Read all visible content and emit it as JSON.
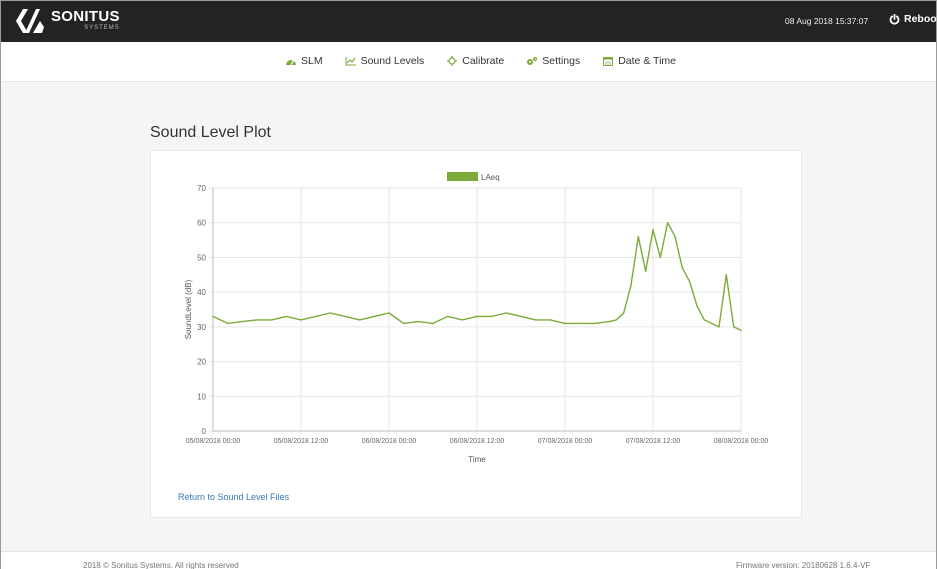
{
  "header": {
    "brand_name": "SONITUS",
    "brand_sub": "SYSTEMS",
    "datetime": "08 Aug 2018 15:37:07",
    "reboot_label": "Reboot"
  },
  "nav": {
    "items": [
      {
        "label": "SLM",
        "icon": "dashboard-icon"
      },
      {
        "label": "Sound Levels",
        "icon": "line-chart-icon"
      },
      {
        "label": "Calibrate",
        "icon": "crosshair-icon"
      },
      {
        "label": "Settings",
        "icon": "cogs-icon"
      },
      {
        "label": "Date & Time",
        "icon": "calendar-icon"
      }
    ]
  },
  "page": {
    "title": "Sound Level Plot",
    "return_link": "Return to Sound Level Files"
  },
  "chart_data": {
    "type": "line",
    "ylabel": "SoundLevel (dB)",
    "xlabel": "Time",
    "ylim": [
      0,
      70
    ],
    "yticks": [
      0,
      10,
      20,
      30,
      40,
      50,
      60,
      70
    ],
    "xticks": [
      "05/08/2018 00:00",
      "05/08/2018 12:00",
      "06/08/2018 00:00",
      "06/08/2018 12:00",
      "07/08/2018 00:00",
      "07/08/2018 12:00",
      "08/08/2018 00:00"
    ],
    "xlim": [
      "05/08/2018 00:00",
      "08/08/2018 00:00"
    ],
    "grid": true,
    "legend": "top-center",
    "color": "#7cab3a",
    "series": [
      {
        "name": "LAeq",
        "x": [
          "05/08/2018 00:00",
          "05/08/2018 02:00",
          "05/08/2018 04:00",
          "05/08/2018 06:00",
          "05/08/2018 08:00",
          "05/08/2018 10:00",
          "05/08/2018 12:00",
          "05/08/2018 14:00",
          "05/08/2018 16:00",
          "05/08/2018 18:00",
          "05/08/2018 20:00",
          "05/08/2018 22:00",
          "06/08/2018 00:00",
          "06/08/2018 02:00",
          "06/08/2018 04:00",
          "06/08/2018 06:00",
          "06/08/2018 08:00",
          "06/08/2018 10:00",
          "06/08/2018 12:00",
          "06/08/2018 14:00",
          "06/08/2018 16:00",
          "06/08/2018 18:00",
          "06/08/2018 20:00",
          "06/08/2018 22:00",
          "07/08/2018 00:00",
          "07/08/2018 02:00",
          "07/08/2018 04:00",
          "07/08/2018 06:00",
          "07/08/2018 07:00",
          "07/08/2018 08:00",
          "07/08/2018 09:00",
          "07/08/2018 10:00",
          "07/08/2018 11:00",
          "07/08/2018 12:00",
          "07/08/2018 13:00",
          "07/08/2018 14:00",
          "07/08/2018 15:00",
          "07/08/2018 16:00",
          "07/08/2018 17:00",
          "07/08/2018 18:00",
          "07/08/2018 19:00",
          "07/08/2018 20:00",
          "07/08/2018 21:00",
          "07/08/2018 22:00",
          "07/08/2018 23:00",
          "08/08/2018 00:00"
        ],
        "values": [
          33,
          31,
          31.5,
          32,
          32,
          33,
          32,
          33,
          34,
          33,
          32,
          33,
          34,
          31,
          31.5,
          31,
          33,
          32,
          33,
          33,
          34,
          33,
          32,
          32,
          31,
          31,
          31,
          31.5,
          32,
          34,
          42,
          56,
          46,
          58,
          50,
          60,
          56,
          47,
          43,
          36,
          32,
          31,
          30,
          45,
          30,
          29
        ]
      }
    ]
  },
  "footer": {
    "copyright": "2018 © Sonitus Systems. All rights reserved",
    "firmware": "Firmware version: 20180628 1.6.4-VF"
  }
}
